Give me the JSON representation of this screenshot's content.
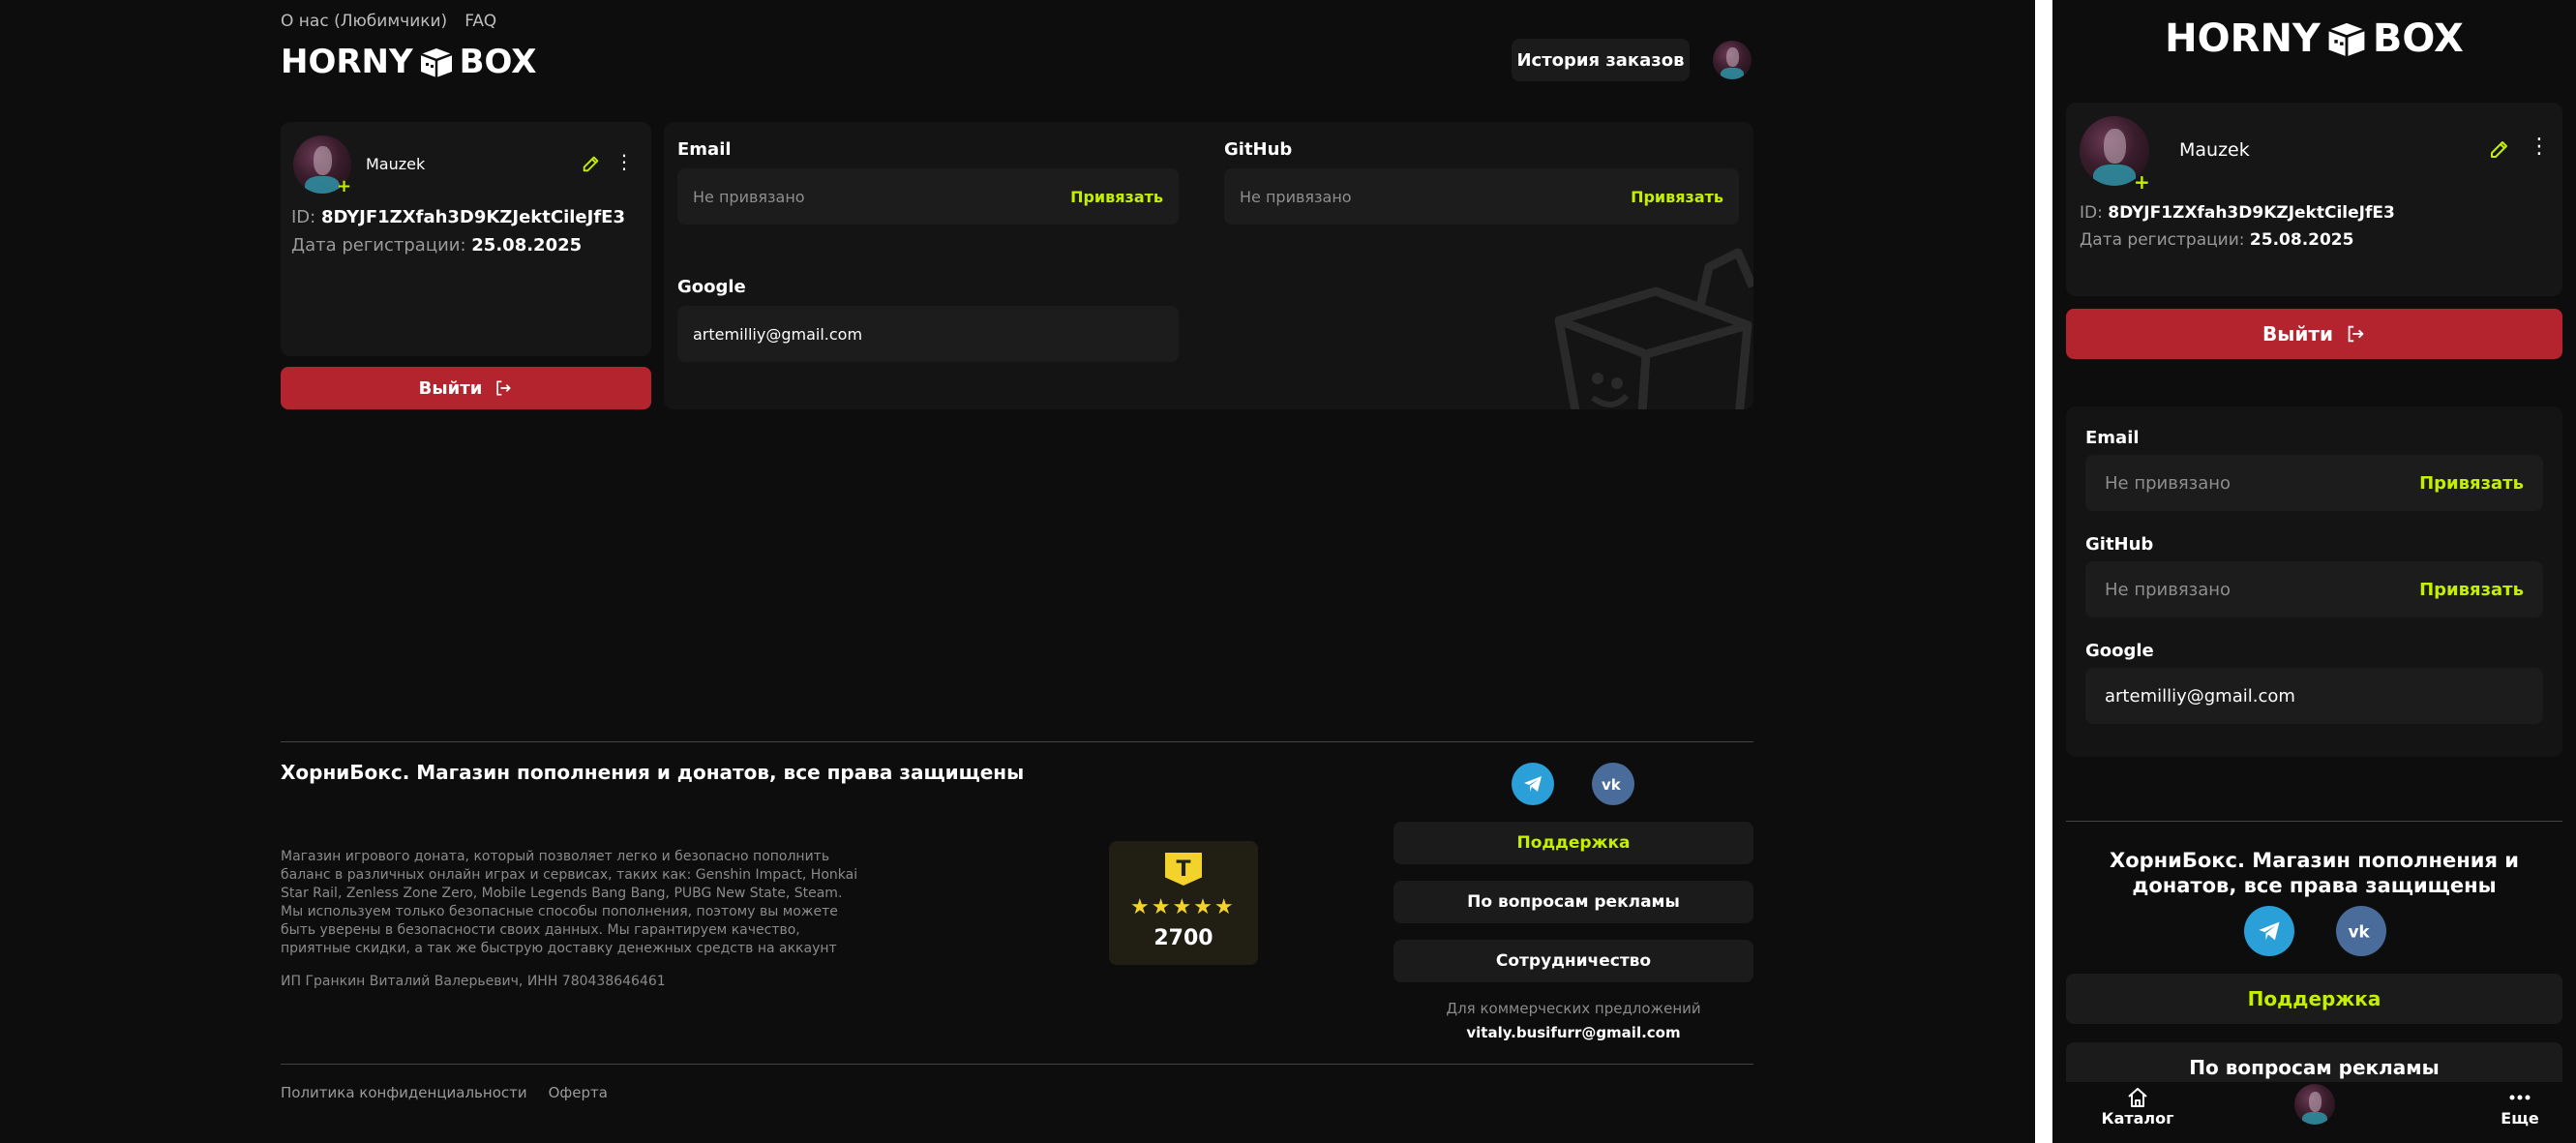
{
  "header": {
    "nav_links": [
      "О нас (Любимчики)",
      "FAQ"
    ],
    "logo_left": "HORNY",
    "logo_right": "BOX",
    "orders_button": "История заказов"
  },
  "profile": {
    "username": "Mauzek",
    "id_label": "ID:",
    "id_value": "8DYJF1ZXfah3D9KZJektCileJfE3",
    "reg_label": "Дата регистрации:",
    "reg_value": "25.08.2025",
    "logout_label": "Выйти"
  },
  "links": {
    "email": {
      "label": "Email",
      "value": "Не привязано",
      "action": "Привязать"
    },
    "github": {
      "label": "GitHub",
      "value": "Не привязано",
      "action": "Привязать"
    },
    "google": {
      "label": "Google",
      "value": "artemilliy@gmail.com"
    }
  },
  "footer": {
    "title": "ХорниБокс. Магазин пополнения и донатов, все права защищены",
    "description": "Магазин игрового доната, который позволяет легко и безопасно пополнить баланс в различных онлайн играх и сервисах, таких как: Genshin Impact, Honkai Star Rail, Zenless Zone Zero, Mobile Legends Bang Bang, PUBG New State, Steam. Мы используем только безопасные способы пополнения, поэтому вы можете быть уверены в безопасности своих данных. Мы гарантируем качество, приятные скидки, а так же быструю доставку денежных средств на аккаунт",
    "legal": "ИП Гранкин Виталий Валерьевич, ИНН 780438646461",
    "rating": {
      "logo_letter": "T",
      "stars": "★★★★★",
      "count": "2700"
    },
    "buttons": {
      "support": "Поддержка",
      "ads": "По вопросам рекламы",
      "partnership": "Сотрудничество"
    },
    "commercial_label": "Для коммерческих предложений",
    "commercial_email": "vitaly.busifurr@gmail.com",
    "bottom_links": [
      "Политика конфиденциальности",
      "Оферта"
    ]
  },
  "mobile_nav": {
    "catalog": "Каталог",
    "more": "Еще"
  },
  "colors": {
    "accent": "#c4f000",
    "danger": "#b3242f",
    "bg": "#0d0d0d",
    "card": "#161616",
    "telegram": "#2a9fd8",
    "vk": "#4a6c9b",
    "star": "#f3d32b"
  },
  "icons": [
    "box-logo-icon",
    "pencil-icon",
    "more-vertical-icon",
    "logout-icon",
    "telegram-icon",
    "vk-icon",
    "home-icon",
    "more-horizontal-icon"
  ]
}
